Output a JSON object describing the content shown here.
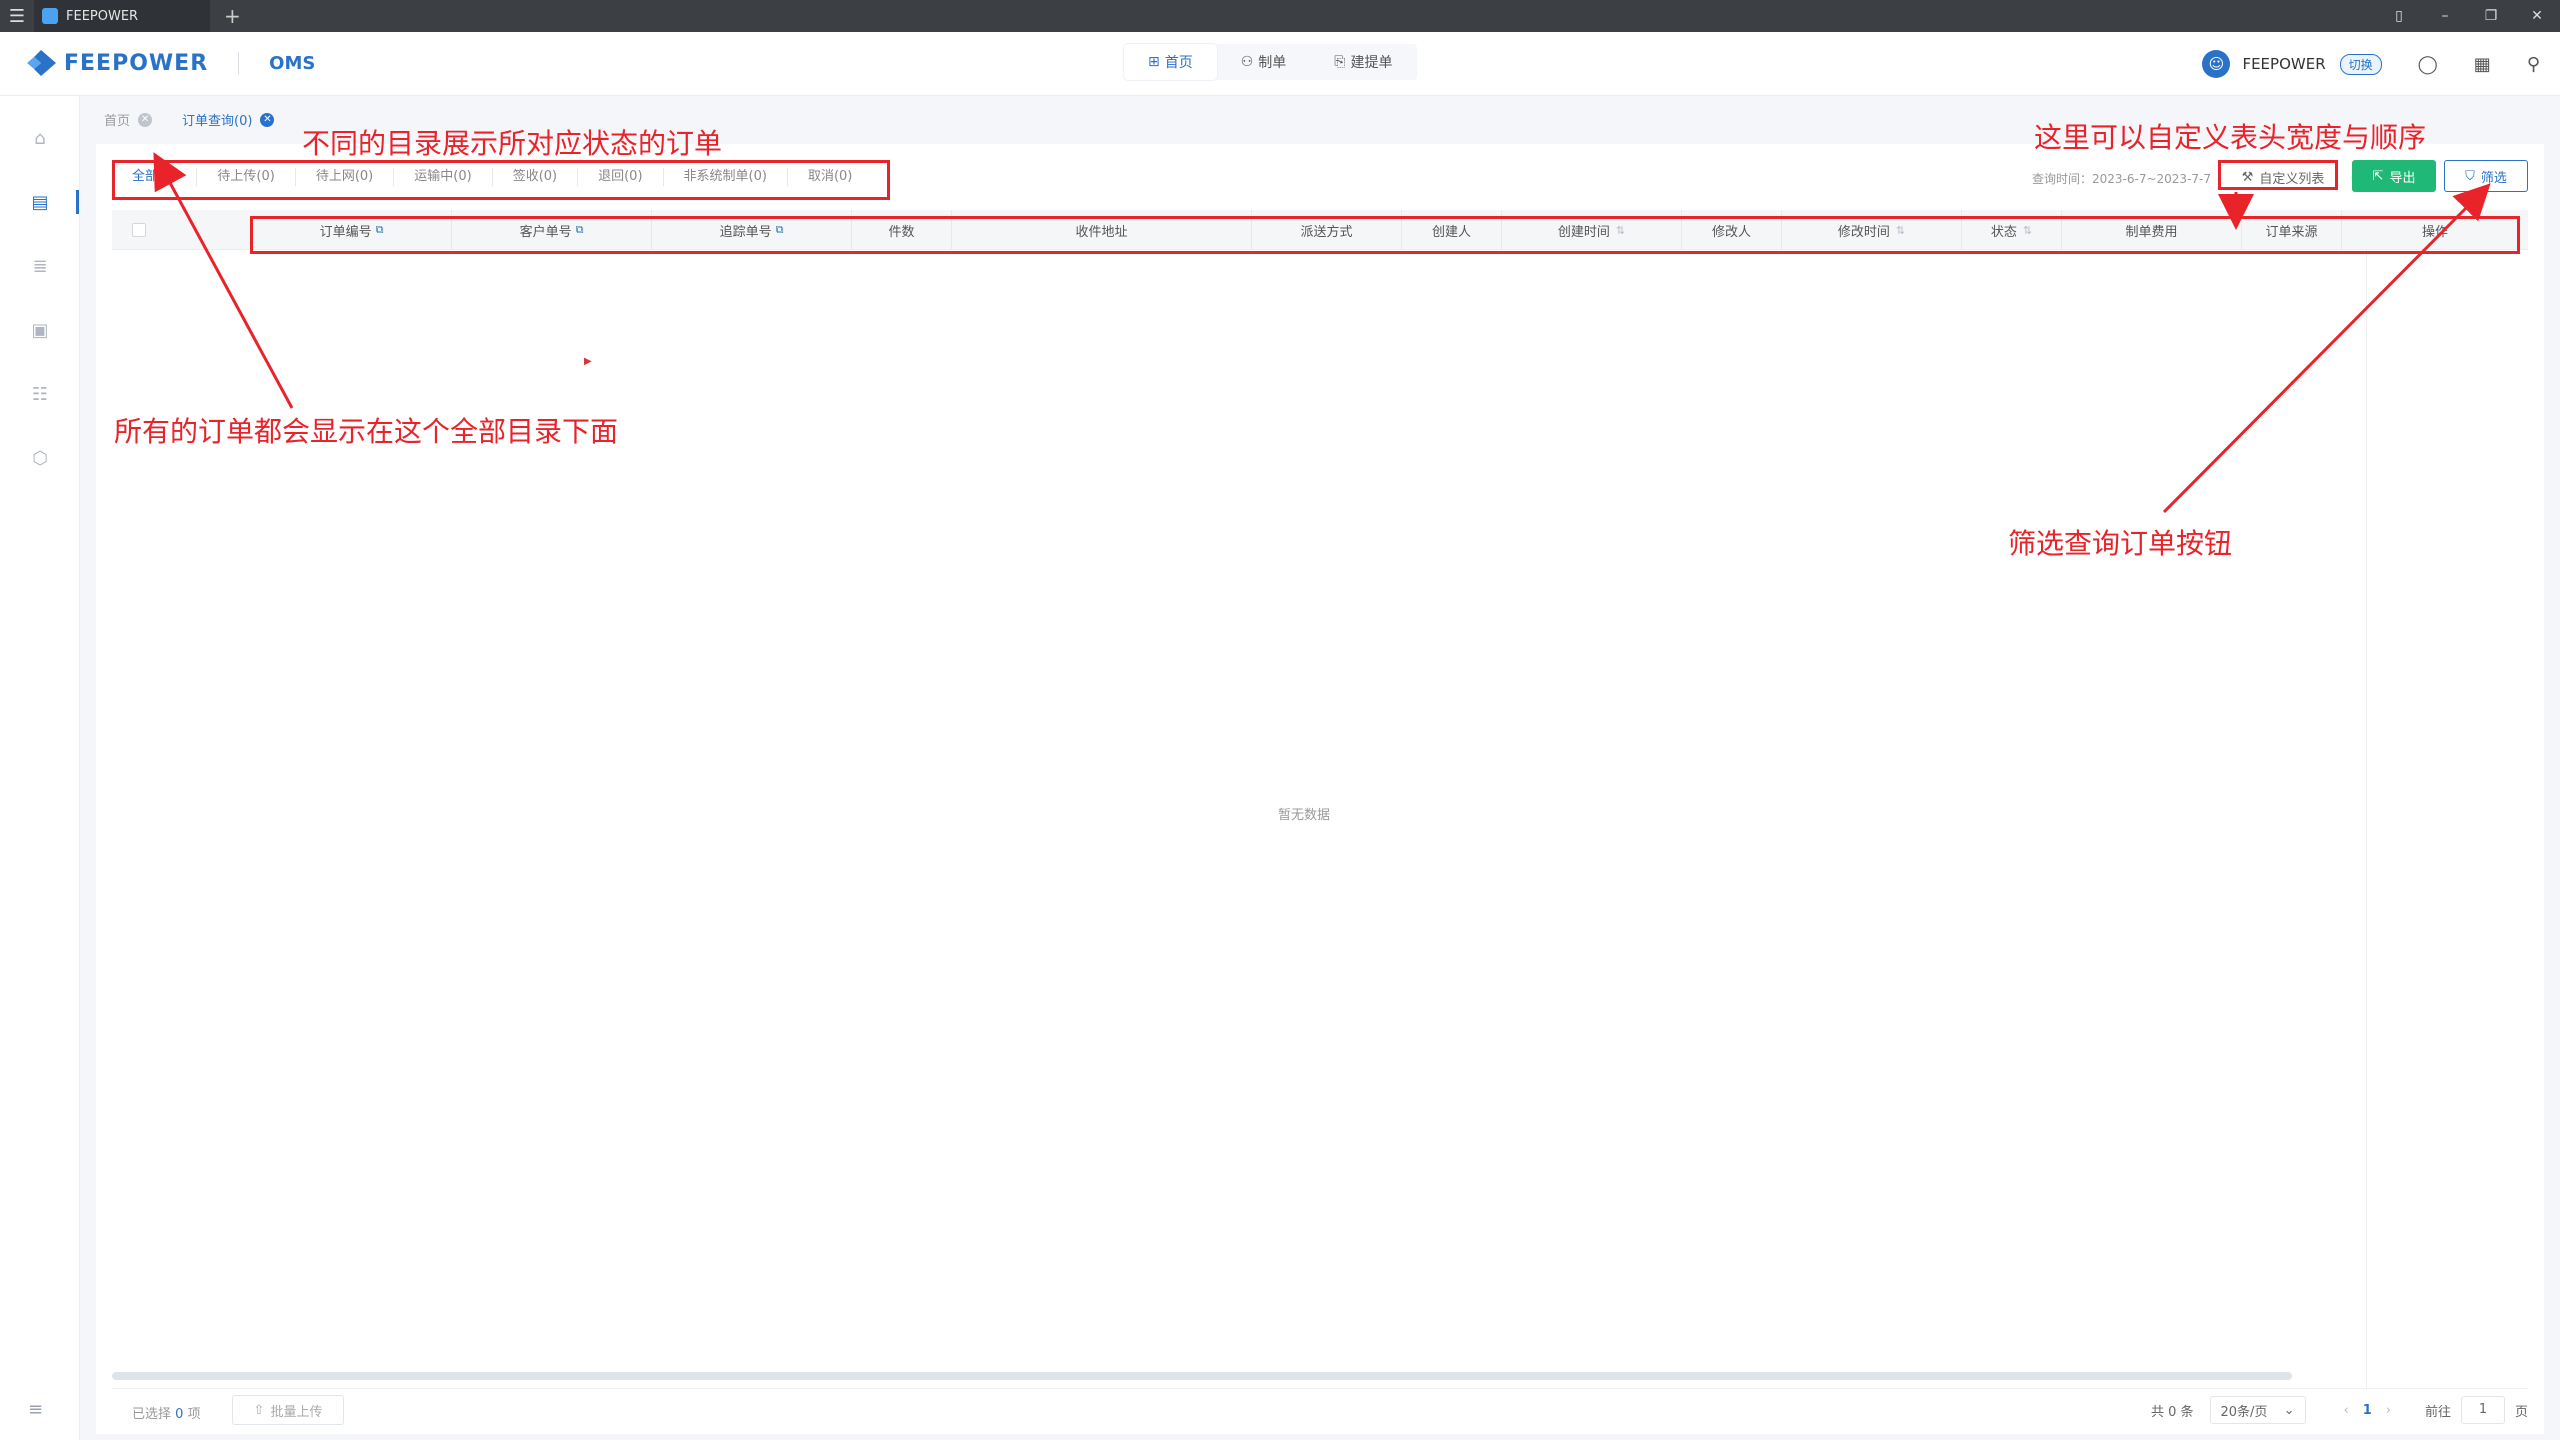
{
  "window": {
    "tab_title": "FEEPOWER",
    "plus": "+"
  },
  "header": {
    "brand": "FEEPOWER",
    "product": "OMS",
    "nav": [
      {
        "label": "首页",
        "icon": "grid-icon"
      },
      {
        "label": "制单",
        "icon": "user-doc-icon"
      },
      {
        "label": "建提单",
        "icon": "doc-plus-icon"
      }
    ],
    "username": "FEEPOWER",
    "switch_label": "切换"
  },
  "breadcrumbs": [
    {
      "label": "首页"
    },
    {
      "label": "订单查询(0)"
    }
  ],
  "status_tabs": [
    "全部(0)",
    "待上传(0)",
    "待上网(0)",
    "运输中(0)",
    "签收(0)",
    "退回(0)",
    "非系统制单(0)",
    "取消(0)"
  ],
  "toolbar": {
    "query_time": "查询时间：2023-6-7~2023-7-7",
    "custom_columns": "自定义列表",
    "export": "导出",
    "filter": "筛选"
  },
  "table": {
    "columns": [
      "订单编号",
      "客户单号",
      "追踪单号",
      "件数",
      "收件地址",
      "派送方式",
      "创建人",
      "创建时间",
      "修改人",
      "修改时间",
      "状态",
      "制单费用",
      "订单来源",
      "操作"
    ],
    "empty_text": "暂无数据"
  },
  "footer": {
    "selected_prefix": "已选择",
    "selected_count": "0",
    "selected_suffix": "项",
    "batch_upload": "批量上传",
    "total": "共 0 条",
    "page_size": "20条/页",
    "current_page": "1",
    "goto_label": "前往",
    "goto_value": "1",
    "page_suffix": "页"
  },
  "annotations": {
    "tabs_note": "不同的目录展示所对应状态的订单",
    "columns_note": "这里可以自定义表头宽度与顺序",
    "all_note": "所有的订单都会显示在这个全部目录下面",
    "filter_note": "筛选查询订单按钮"
  },
  "colors": {
    "accent": "#2a72c8",
    "export_green": "#20b877",
    "annotation_red": "#e8232a"
  }
}
